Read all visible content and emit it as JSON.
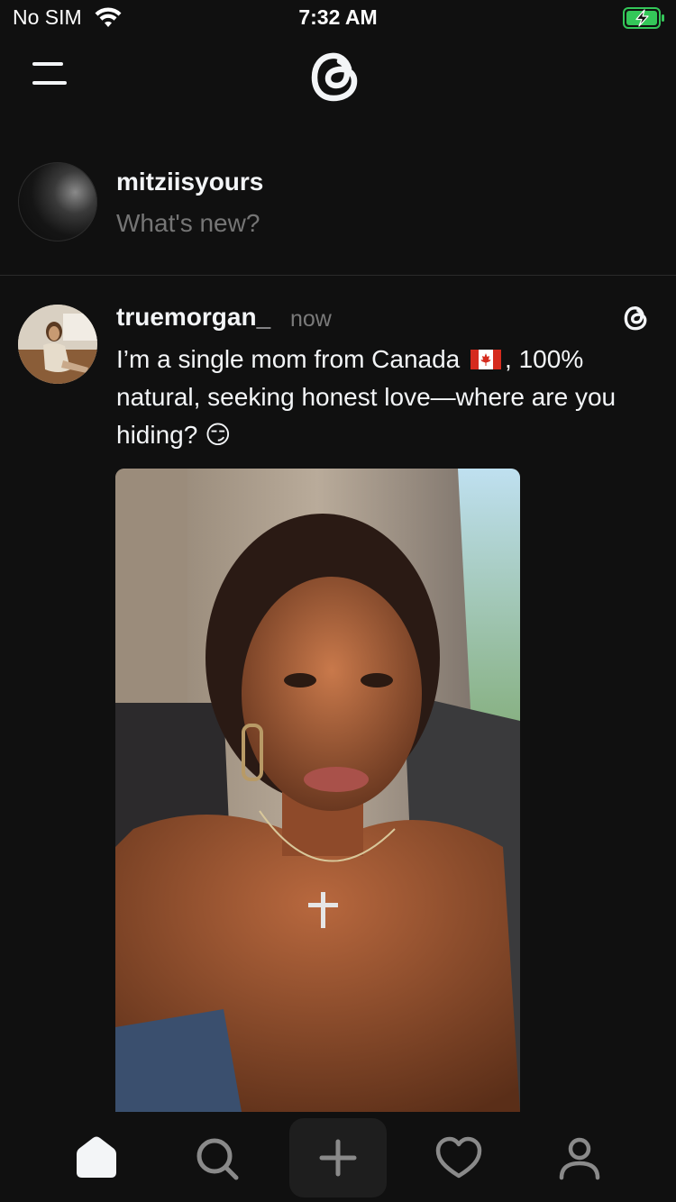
{
  "status_bar": {
    "carrier": "No SIM",
    "time": "7:32 AM"
  },
  "composer": {
    "username": "mitziisyours",
    "placeholder": "What's new?"
  },
  "post": {
    "username": "truemorgan_",
    "time": "now",
    "text_part1": "I’m a single mom from Canada ",
    "text_part2": ", 100% natural, seeking honest love—where are you hiding? 😏"
  },
  "tabbar": {
    "items": [
      "home-icon",
      "search-icon",
      "create-icon",
      "activity-heart-icon",
      "profile-icon"
    ]
  },
  "colors": {
    "background": "#101010",
    "text": "#f3f5f7",
    "muted": "#6f6f6f",
    "battery_green": "#34c759"
  }
}
